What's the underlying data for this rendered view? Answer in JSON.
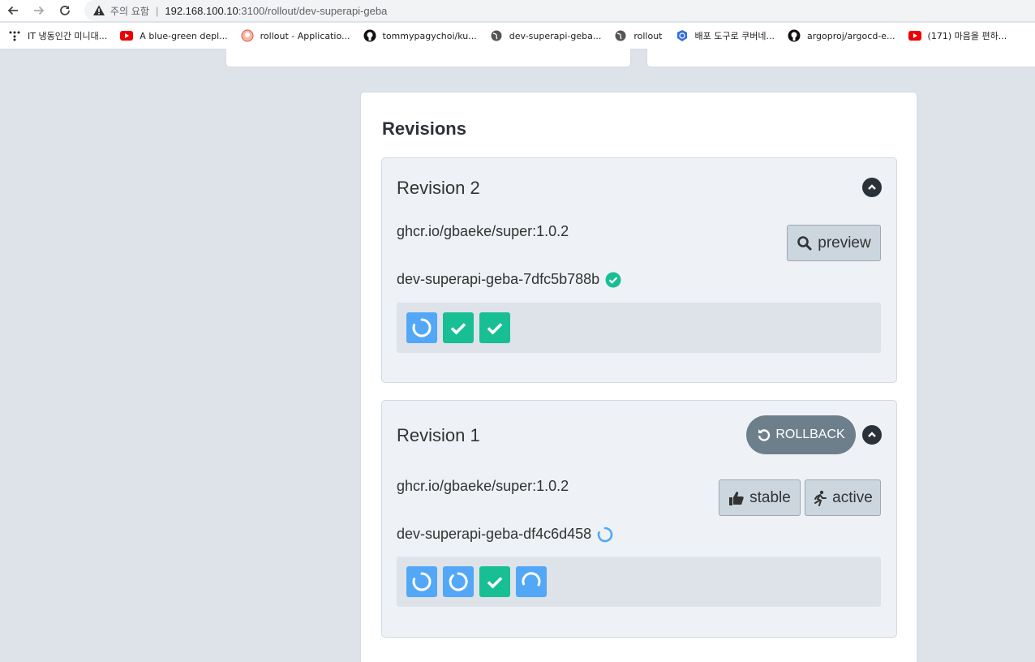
{
  "browser": {
    "security_label": "주의 요함",
    "url_host": "192.168.100.10",
    "url_path": ":3100/rollout/dev-superapi-geba",
    "bookmarks": [
      {
        "label": "IT 냉동인간 미니대...",
        "icon": "dots-icon"
      },
      {
        "label": "A blue-green depl...",
        "icon": "youtube-icon"
      },
      {
        "label": "rollout - Applicatio...",
        "icon": "argo-icon"
      },
      {
        "label": "tommypagychoi/ku...",
        "icon": "github-icon"
      },
      {
        "label": "dev-superapi-geba...",
        "icon": "globe-icon"
      },
      {
        "label": "rollout",
        "icon": "globe-icon"
      },
      {
        "label": "배포 도구로 쿠버네...",
        "icon": "kubernetes-icon"
      },
      {
        "label": "argoproj/argocd-e...",
        "icon": "github-icon"
      },
      {
        "label": "(171) 마음을 편하...",
        "icon": "youtube-icon"
      }
    ]
  },
  "colors": {
    "page_bg": "#dee3e9",
    "pod_running": "#52a7f7",
    "pod_ready": "#18be94",
    "status_ok": "#18be94",
    "rollback_bg": "#6d7f8b"
  },
  "panel": {
    "title": "Revisions"
  },
  "revisions": [
    {
      "title": "Revision 2",
      "image": "ghcr.io/gbaeke/super:1.0.2",
      "replicaset": "dev-superapi-geba-7dfc5b788b",
      "rs_status": "healthy",
      "preview_label": "preview",
      "pods": [
        "progressing",
        "healthy",
        "healthy"
      ]
    },
    {
      "title": "Revision 1",
      "image": "ghcr.io/gbaeke/super:1.0.2",
      "replicaset": "dev-superapi-geba-df4c6d458",
      "rs_status": "progressing",
      "rollback_label": "ROLLBACK",
      "stable_label": "stable",
      "active_label": "active",
      "pods": [
        "progressing",
        "progressing",
        "healthy",
        "progressing"
      ]
    }
  ]
}
